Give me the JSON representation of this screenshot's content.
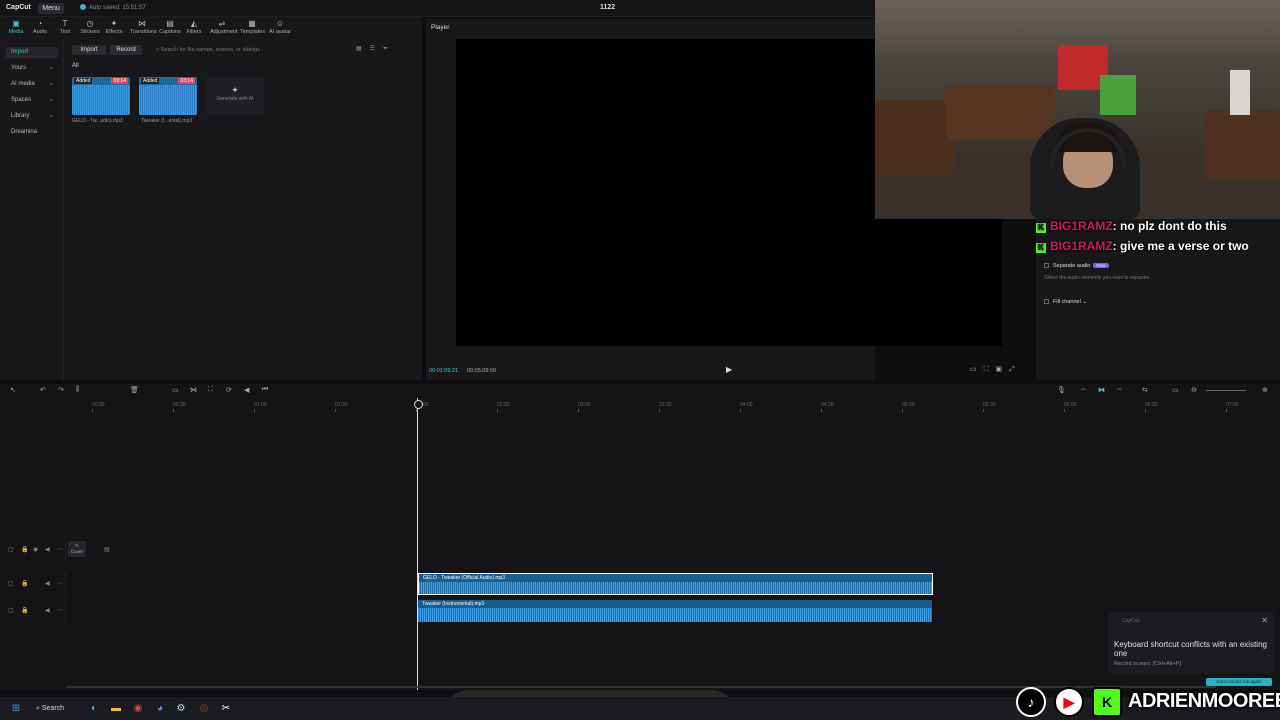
{
  "titlebar": {
    "app_name": "CapCut",
    "menu_label": "Menu",
    "autosave": "Auto saved: 15:51:57",
    "project_title": "1122"
  },
  "toolbar": {
    "tools": [
      {
        "label": "Media",
        "icon": "media-icon"
      },
      {
        "label": "Audio",
        "icon": "audio-icon"
      },
      {
        "label": "Text",
        "icon": "text-icon"
      },
      {
        "label": "Stickers",
        "icon": "stickers-icon"
      },
      {
        "label": "Effects",
        "icon": "effects-icon"
      },
      {
        "label": "Transitions",
        "icon": "transitions-icon"
      },
      {
        "label": "Captions",
        "icon": "captions-icon"
      },
      {
        "label": "Filters",
        "icon": "filters-icon"
      },
      {
        "label": "Adjustment",
        "icon": "adjustment-icon"
      },
      {
        "label": "Templates",
        "icon": "templates-icon"
      },
      {
        "label": "AI avatar",
        "icon": "ai-avatar-icon"
      }
    ]
  },
  "leftnav": {
    "items": [
      {
        "label": "Import"
      },
      {
        "label": "Yours"
      },
      {
        "label": "AI media"
      },
      {
        "label": "Spaces"
      },
      {
        "label": "Library"
      },
      {
        "label": "Dreamina"
      }
    ]
  },
  "media": {
    "import_label": "Import",
    "record_label": "Record",
    "search_placeholder": "Search for file names, scenes, or dialogs",
    "all_tab": "All",
    "items": [
      {
        "added": "Added",
        "duration": "03:14",
        "name": "GELO - Tw...udio).mp3"
      },
      {
        "added": "Added",
        "duration": "03:14",
        "name": "Tweaker (I...ental).mp3"
      }
    ],
    "generate_label": "Generate with AI"
  },
  "player": {
    "title": "Player",
    "current_time": "00:01:59:21",
    "total_time": "00:05:09:09"
  },
  "rightpanel": {
    "separate_audio": "Separate audio",
    "badge": "Free",
    "separate_desc": "Select the audio elements you want to separate.",
    "fill_channel": "Fill channel"
  },
  "chat": [
    {
      "user": "BIG1RAMZ",
      "message": ": no plz dont do this"
    },
    {
      "user": "BIG1RAMZ",
      "message": ": give me a verse or two"
    }
  ],
  "timeline": {
    "ruler_ticks": [
      "00:00",
      "00:30",
      "01:00",
      "01:30",
      "02:00",
      "02:30",
      "03:00",
      "03:30",
      "04:00",
      "04:30",
      "05:00",
      "05:30",
      "06:00",
      "06:30",
      "07:00"
    ],
    "cover_label": "Cover",
    "clips": [
      {
        "name": "GELO - Tweaker (Official Audio).mp3"
      },
      {
        "name": "Tweaker (Instrumental).mp3"
      }
    ]
  },
  "toast": {
    "app": "CapCut",
    "message": "Keyboard shortcut conflicts with an existing one",
    "sub": "Record screen: [Ctrl+Alt+P]",
    "button": "Don't remind me again"
  },
  "taskbar": {
    "search_label": "Search"
  },
  "overlay": {
    "handle": "ADRIENMOOREEE"
  },
  "colors": {
    "accent": "#3ec6d6",
    "clip": "#1a5d8e",
    "chat_user": "#d41a5a",
    "kick_green": "#53fc18"
  }
}
